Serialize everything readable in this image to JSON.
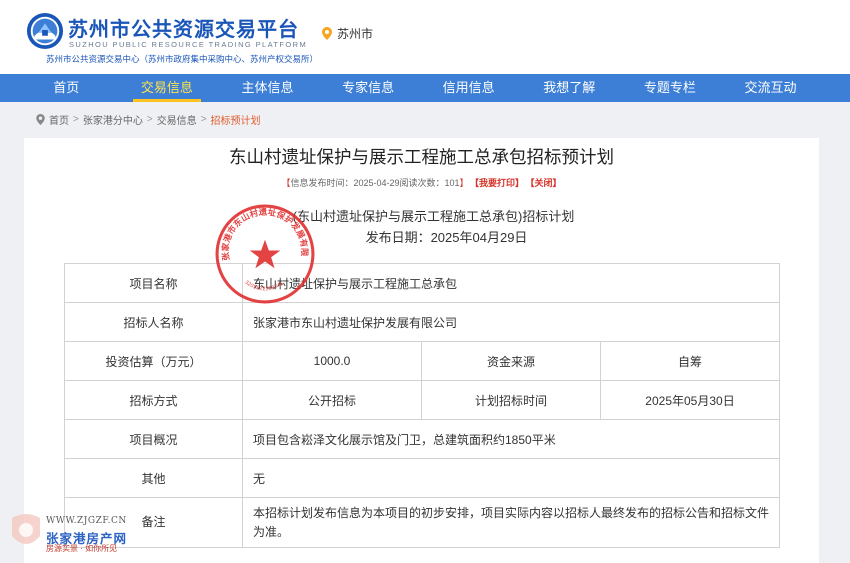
{
  "header": {
    "brand_cn": "苏州市公共资源交易平台",
    "brand_en": "SUZHOU PUBLIC RESOURCE TRADING PLATFORM",
    "brand_sub": "苏州市公共资源交易中心（苏州市政府集中采购中心、苏州产权交易所）",
    "location": "苏州市"
  },
  "nav": {
    "items": [
      {
        "label": "首页"
      },
      {
        "label": "交易信息"
      },
      {
        "label": "主体信息"
      },
      {
        "label": "专家信息"
      },
      {
        "label": "信用信息"
      },
      {
        "label": "我想了解"
      },
      {
        "label": "专题专栏"
      },
      {
        "label": "交流互动"
      }
    ],
    "active": "交易信息"
  },
  "breadcrumb": {
    "items": [
      "首页",
      "张家港分中心",
      "交易信息"
    ],
    "current": "招标预计划",
    "separator": ">"
  },
  "article": {
    "title": "东山村遗址保护与展示工程施工总承包招标预计划",
    "meta_open": "【",
    "meta_text": "信息发布时间：2025-04-29阅读次数：101",
    "meta_close": "】",
    "print_label": "【我要打印】",
    "close_label": "【关闭】",
    "doc_title": "(东山村遗址保护与展示工程施工总承包)招标计划",
    "doc_date": "发布日期：2025年04月29日"
  },
  "table": {
    "project_name_label": "项目名称",
    "project_name": "东山村遗址保护与展示工程施工总承包",
    "tenderer_label": "招标人名称",
    "tenderer": "张家港市东山村遗址保护发展有限公司",
    "investment_label": "投资估算（万元）",
    "investment": "1000.0",
    "fund_source_label": "资金来源",
    "fund_source": "自筹",
    "method_label": "招标方式",
    "method": "公开招标",
    "plan_time_label": "计划招标时间",
    "plan_time": "2025年05月30日",
    "overview_label": "项目概况",
    "overview": "项目包含崧泽文化展示馆及门卫，总建筑面积约1850平米",
    "other_label": "其他",
    "other": "无",
    "remark_label": "备注",
    "remark": "本招标计划发布信息为本项目的初步安排，项目实际内容以招标人最终发布的招标公告和招标文件为准。"
  },
  "seal": {
    "text": "张家港市东山村遗址保护发展有限公司",
    "code": "3205822309745"
  },
  "watermark": {
    "url": "WWW.ZJGZF.CN",
    "name": "张家港房产网",
    "slogan": "房源实景 · 如你所见"
  },
  "colors": {
    "nav_bg": "#3d7fd6",
    "nav_active": "#ffe34d",
    "brand": "#1a56b8",
    "highlight": "#e15a2b",
    "seal": "#e02a2a"
  }
}
